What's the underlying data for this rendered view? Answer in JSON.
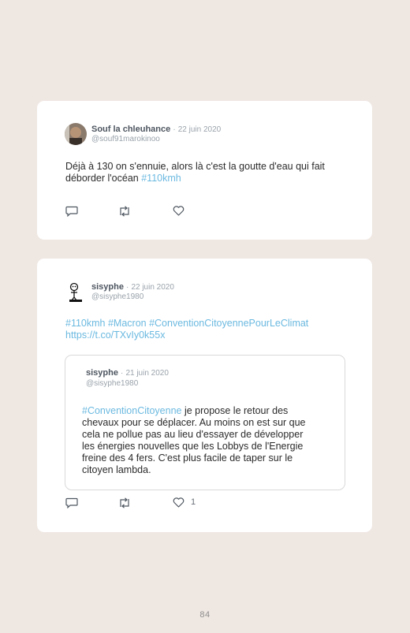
{
  "tweet1": {
    "author": "Souf la chleuhance",
    "separator": "·",
    "date": "22 juin 2020",
    "handle": "@souf91marokinoo",
    "text_line1": "Déjà à 130 on s'ennuie, alors là c'est la goutte d'eau qui fait",
    "text_line2": "déborder l'océan",
    "hashtag": "#110kmh"
  },
  "tweet2": {
    "author": "sisyphe",
    "separator": "·",
    "date": "22 juin 2020",
    "handle": "@sisyphe1980",
    "hashtags_line": "#110kmh #Macron #ConventionCitoyennePourLeClimat",
    "link": "https://t.co/TXvIy0k55x",
    "like_count": "1",
    "quoted": {
      "author": "sisyphe",
      "separator": "·",
      "date": "21 juin 2020",
      "handle": "@sisyphe1980",
      "hashtag": "#ConventionCitoyenne",
      "line1_rest": " je propose le retour des",
      "line2": "chevaux pour se déplacer. Au moins on est sur que",
      "line3": "cela ne pollue pas au lieu d'essayer de développer",
      "line4": "les énergies nouvelles que les Lobbys de l'Energie",
      "line5": "freine des 4 fers. C'est plus facile de taper sur le",
      "line6": "citoyen lambda."
    }
  },
  "icons": {
    "reply": "speech-bubble",
    "retweet": "retweet-arrows",
    "like": "heart-outline"
  },
  "colors": {
    "background": "#efe7e2",
    "card": "#ffffff",
    "hashtag": "#6bb9e0",
    "muted": "#9aa3ab"
  },
  "page_number": "84"
}
